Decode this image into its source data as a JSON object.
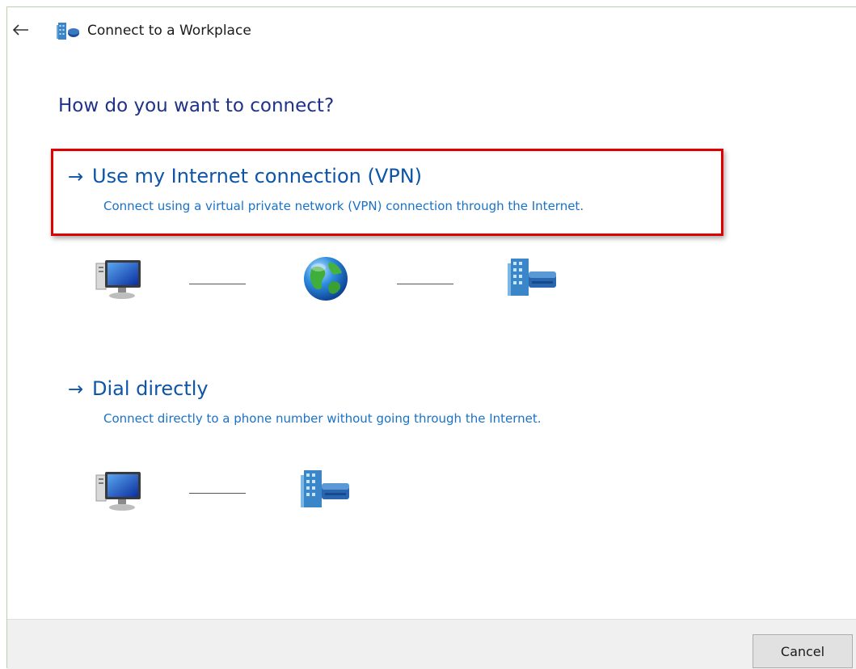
{
  "window": {
    "title": "Connect to a Workplace",
    "title_icon": "workplace-building-icon",
    "back_icon": "back-arrow-icon"
  },
  "main": {
    "heading": "How do you want to connect?",
    "options": [
      {
        "arrow": "→",
        "title": "Use my Internet connection (VPN)",
        "description": "Connect using a virtual private network (VPN) connection through the Internet.",
        "highlighted": true,
        "diagram": [
          "computer-icon",
          "globe-icon",
          "workplace-building-icon"
        ]
      },
      {
        "arrow": "→",
        "title": "Dial directly",
        "description": "Connect directly to a phone number without going through the Internet.",
        "highlighted": false,
        "diagram": [
          "computer-icon",
          "workplace-building-icon"
        ]
      }
    ]
  },
  "footer": {
    "cancel_label": "Cancel"
  },
  "colors": {
    "heading": "#1e3287",
    "link": "#0d55a8",
    "description": "#1a72c8",
    "highlight_border": "#e00000",
    "footer_background": "#f0f0f0"
  }
}
